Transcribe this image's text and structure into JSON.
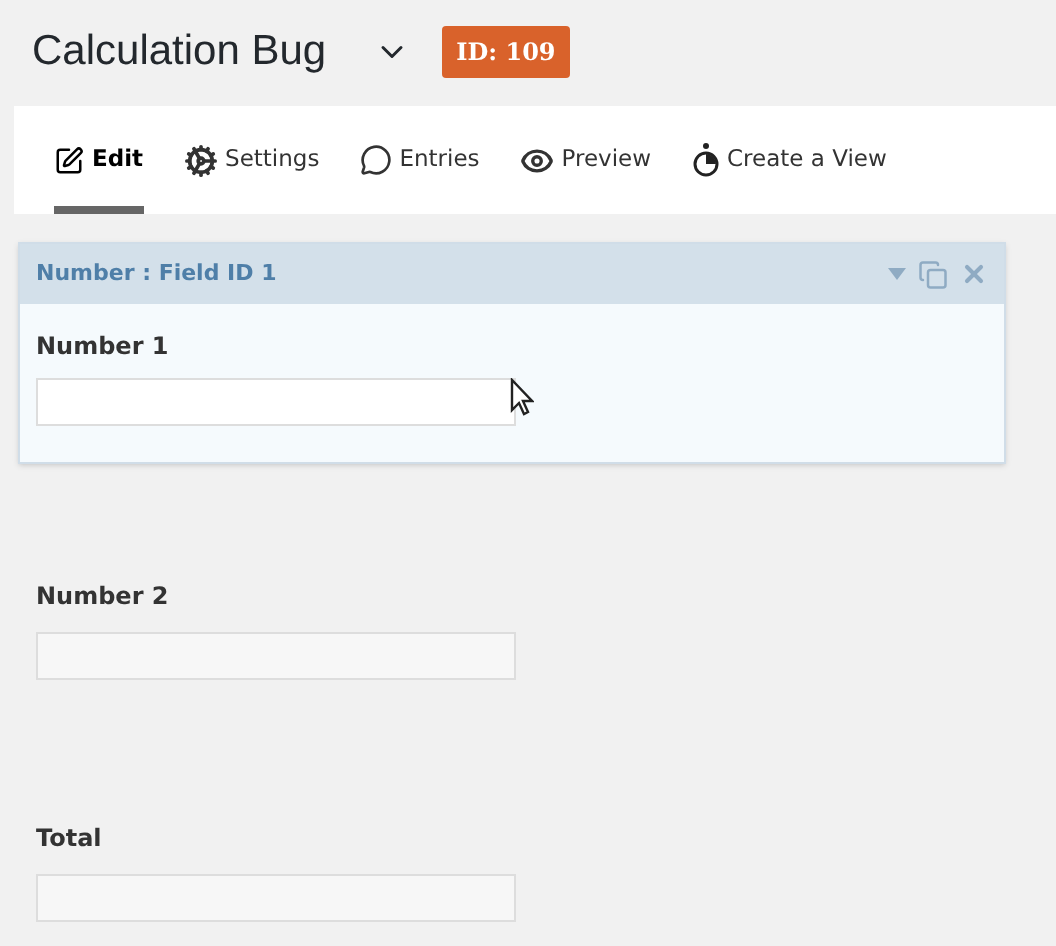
{
  "title": "Calculation Bug",
  "id_badge": "ID: 109",
  "tabs": [
    {
      "label": "Edit",
      "kind": "edit",
      "selected": true
    },
    {
      "label": "Settings",
      "kind": "settings",
      "selected": false
    },
    {
      "label": "Entries",
      "kind": "entries",
      "selected": false
    },
    {
      "label": "Preview",
      "kind": "preview",
      "selected": false
    },
    {
      "label": "Create a View",
      "kind": "view",
      "selected": false
    }
  ],
  "fields": [
    {
      "header": "Number : Field ID 1",
      "label": "Number 1",
      "selected": true
    },
    {
      "label": "Number 2",
      "selected": false
    },
    {
      "label": "Total",
      "selected": false
    }
  ]
}
